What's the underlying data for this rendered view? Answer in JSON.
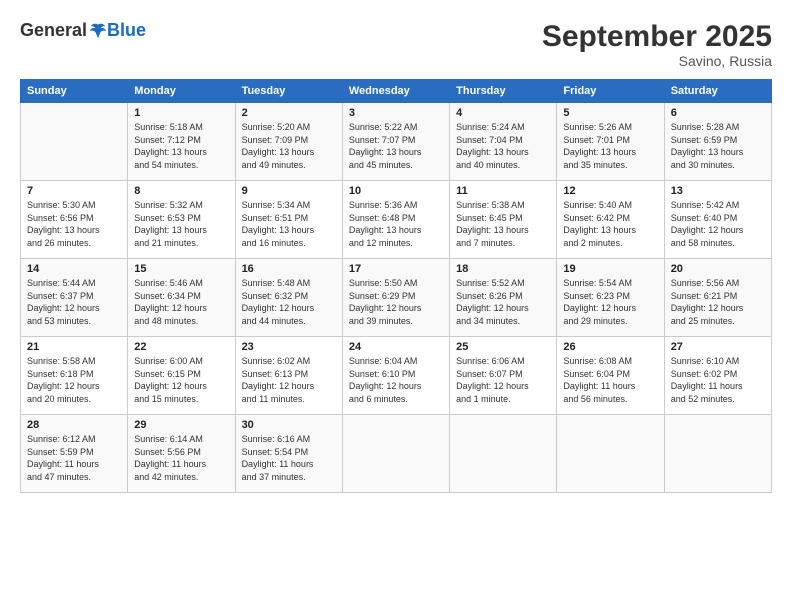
{
  "header": {
    "logo_general": "General",
    "logo_blue": "Blue",
    "month_title": "September 2025",
    "location": "Savino, Russia"
  },
  "columns": [
    "Sunday",
    "Monday",
    "Tuesday",
    "Wednesday",
    "Thursday",
    "Friday",
    "Saturday"
  ],
  "weeks": [
    [
      {
        "day": "",
        "info": ""
      },
      {
        "day": "1",
        "info": "Sunrise: 5:18 AM\nSunset: 7:12 PM\nDaylight: 13 hours\nand 54 minutes."
      },
      {
        "day": "2",
        "info": "Sunrise: 5:20 AM\nSunset: 7:09 PM\nDaylight: 13 hours\nand 49 minutes."
      },
      {
        "day": "3",
        "info": "Sunrise: 5:22 AM\nSunset: 7:07 PM\nDaylight: 13 hours\nand 45 minutes."
      },
      {
        "day": "4",
        "info": "Sunrise: 5:24 AM\nSunset: 7:04 PM\nDaylight: 13 hours\nand 40 minutes."
      },
      {
        "day": "5",
        "info": "Sunrise: 5:26 AM\nSunset: 7:01 PM\nDaylight: 13 hours\nand 35 minutes."
      },
      {
        "day": "6",
        "info": "Sunrise: 5:28 AM\nSunset: 6:59 PM\nDaylight: 13 hours\nand 30 minutes."
      }
    ],
    [
      {
        "day": "7",
        "info": "Sunrise: 5:30 AM\nSunset: 6:56 PM\nDaylight: 13 hours\nand 26 minutes."
      },
      {
        "day": "8",
        "info": "Sunrise: 5:32 AM\nSunset: 6:53 PM\nDaylight: 13 hours\nand 21 minutes."
      },
      {
        "day": "9",
        "info": "Sunrise: 5:34 AM\nSunset: 6:51 PM\nDaylight: 13 hours\nand 16 minutes."
      },
      {
        "day": "10",
        "info": "Sunrise: 5:36 AM\nSunset: 6:48 PM\nDaylight: 13 hours\nand 12 minutes."
      },
      {
        "day": "11",
        "info": "Sunrise: 5:38 AM\nSunset: 6:45 PM\nDaylight: 13 hours\nand 7 minutes."
      },
      {
        "day": "12",
        "info": "Sunrise: 5:40 AM\nSunset: 6:42 PM\nDaylight: 13 hours\nand 2 minutes."
      },
      {
        "day": "13",
        "info": "Sunrise: 5:42 AM\nSunset: 6:40 PM\nDaylight: 12 hours\nand 58 minutes."
      }
    ],
    [
      {
        "day": "14",
        "info": "Sunrise: 5:44 AM\nSunset: 6:37 PM\nDaylight: 12 hours\nand 53 minutes."
      },
      {
        "day": "15",
        "info": "Sunrise: 5:46 AM\nSunset: 6:34 PM\nDaylight: 12 hours\nand 48 minutes."
      },
      {
        "day": "16",
        "info": "Sunrise: 5:48 AM\nSunset: 6:32 PM\nDaylight: 12 hours\nand 44 minutes."
      },
      {
        "day": "17",
        "info": "Sunrise: 5:50 AM\nSunset: 6:29 PM\nDaylight: 12 hours\nand 39 minutes."
      },
      {
        "day": "18",
        "info": "Sunrise: 5:52 AM\nSunset: 6:26 PM\nDaylight: 12 hours\nand 34 minutes."
      },
      {
        "day": "19",
        "info": "Sunrise: 5:54 AM\nSunset: 6:23 PM\nDaylight: 12 hours\nand 29 minutes."
      },
      {
        "day": "20",
        "info": "Sunrise: 5:56 AM\nSunset: 6:21 PM\nDaylight: 12 hours\nand 25 minutes."
      }
    ],
    [
      {
        "day": "21",
        "info": "Sunrise: 5:58 AM\nSunset: 6:18 PM\nDaylight: 12 hours\nand 20 minutes."
      },
      {
        "day": "22",
        "info": "Sunrise: 6:00 AM\nSunset: 6:15 PM\nDaylight: 12 hours\nand 15 minutes."
      },
      {
        "day": "23",
        "info": "Sunrise: 6:02 AM\nSunset: 6:13 PM\nDaylight: 12 hours\nand 11 minutes."
      },
      {
        "day": "24",
        "info": "Sunrise: 6:04 AM\nSunset: 6:10 PM\nDaylight: 12 hours\nand 6 minutes."
      },
      {
        "day": "25",
        "info": "Sunrise: 6:06 AM\nSunset: 6:07 PM\nDaylight: 12 hours\nand 1 minute."
      },
      {
        "day": "26",
        "info": "Sunrise: 6:08 AM\nSunset: 6:04 PM\nDaylight: 11 hours\nand 56 minutes."
      },
      {
        "day": "27",
        "info": "Sunrise: 6:10 AM\nSunset: 6:02 PM\nDaylight: 11 hours\nand 52 minutes."
      }
    ],
    [
      {
        "day": "28",
        "info": "Sunrise: 6:12 AM\nSunset: 5:59 PM\nDaylight: 11 hours\nand 47 minutes."
      },
      {
        "day": "29",
        "info": "Sunrise: 6:14 AM\nSunset: 5:56 PM\nDaylight: 11 hours\nand 42 minutes."
      },
      {
        "day": "30",
        "info": "Sunrise: 6:16 AM\nSunset: 5:54 PM\nDaylight: 11 hours\nand 37 minutes."
      },
      {
        "day": "",
        "info": ""
      },
      {
        "day": "",
        "info": ""
      },
      {
        "day": "",
        "info": ""
      },
      {
        "day": "",
        "info": ""
      }
    ]
  ]
}
